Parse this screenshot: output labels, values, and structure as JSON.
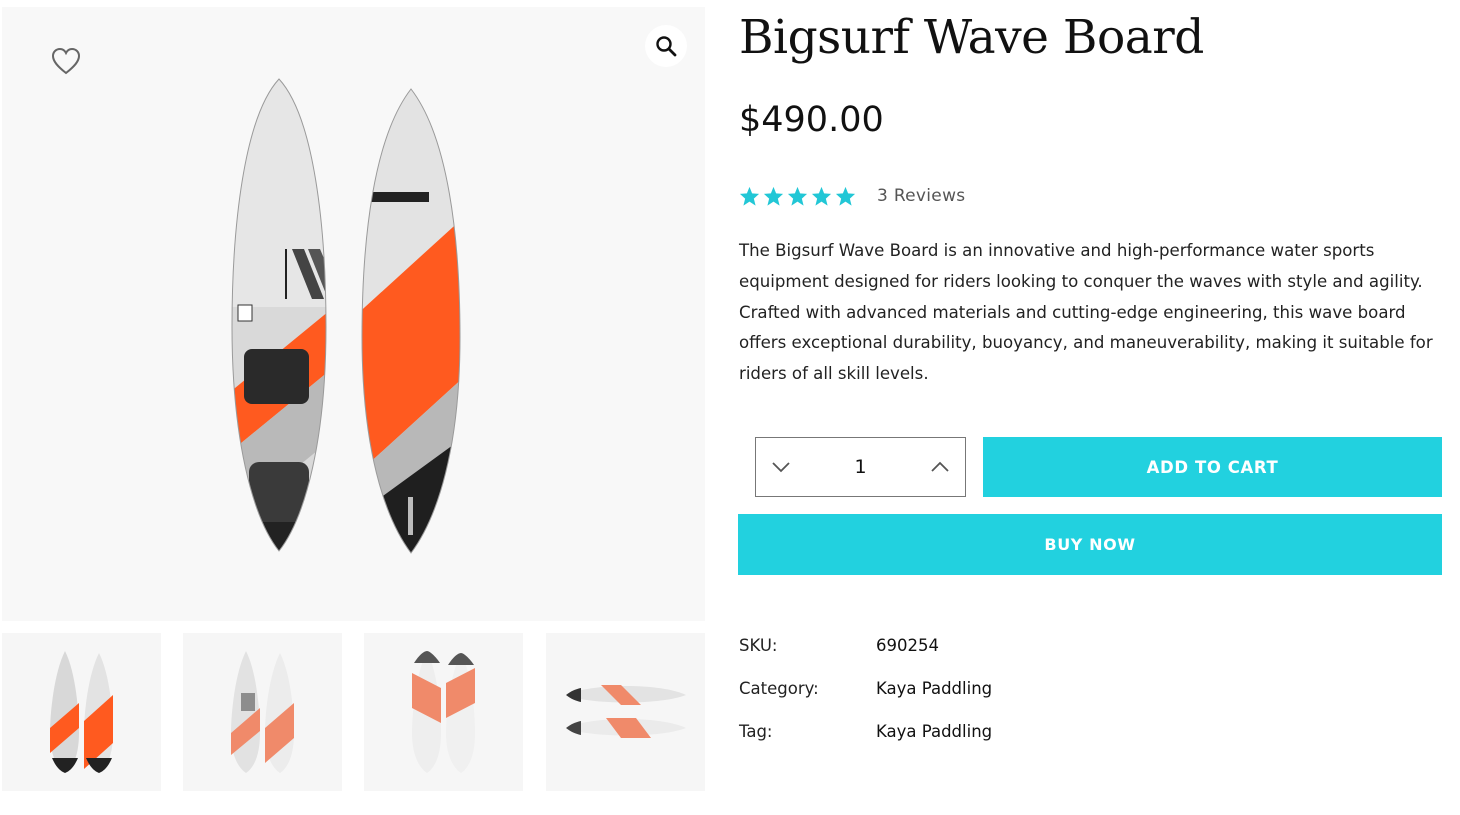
{
  "product": {
    "title": "Bigsurf Wave Board",
    "price": "$490.00",
    "rating": 5,
    "reviews_label": "3 Reviews",
    "description": "The Bigsurf Wave Board is an innovative and high-performance water sports equipment designed for riders looking to conquer the waves with style and agility. Crafted with advanced materials and cutting-edge engineering, this wave board offers exceptional durability, buoyancy, and maneuverability, making it suitable for riders of all skill levels."
  },
  "purchase": {
    "quantity": "1",
    "add_to_cart_label": "ADD TO CART",
    "buy_now_label": "BUY NOW"
  },
  "meta": {
    "sku_label": "SKU:",
    "sku_value": "690254",
    "category_label": "Category:",
    "category_value": "Kaya Paddling",
    "tag_label": "Tag:",
    "tag_value": "Kaya Paddling"
  },
  "gallery": {
    "wishlist_icon": "heart-icon",
    "zoom_icon": "magnifier-icon",
    "thumbnail_count": 4
  },
  "colors": {
    "accent": "#22d1df",
    "star": "#22c7d6",
    "board_orange": "#ff5a1f",
    "board_gray": "#b9b9b9",
    "board_dark": "#222222"
  }
}
